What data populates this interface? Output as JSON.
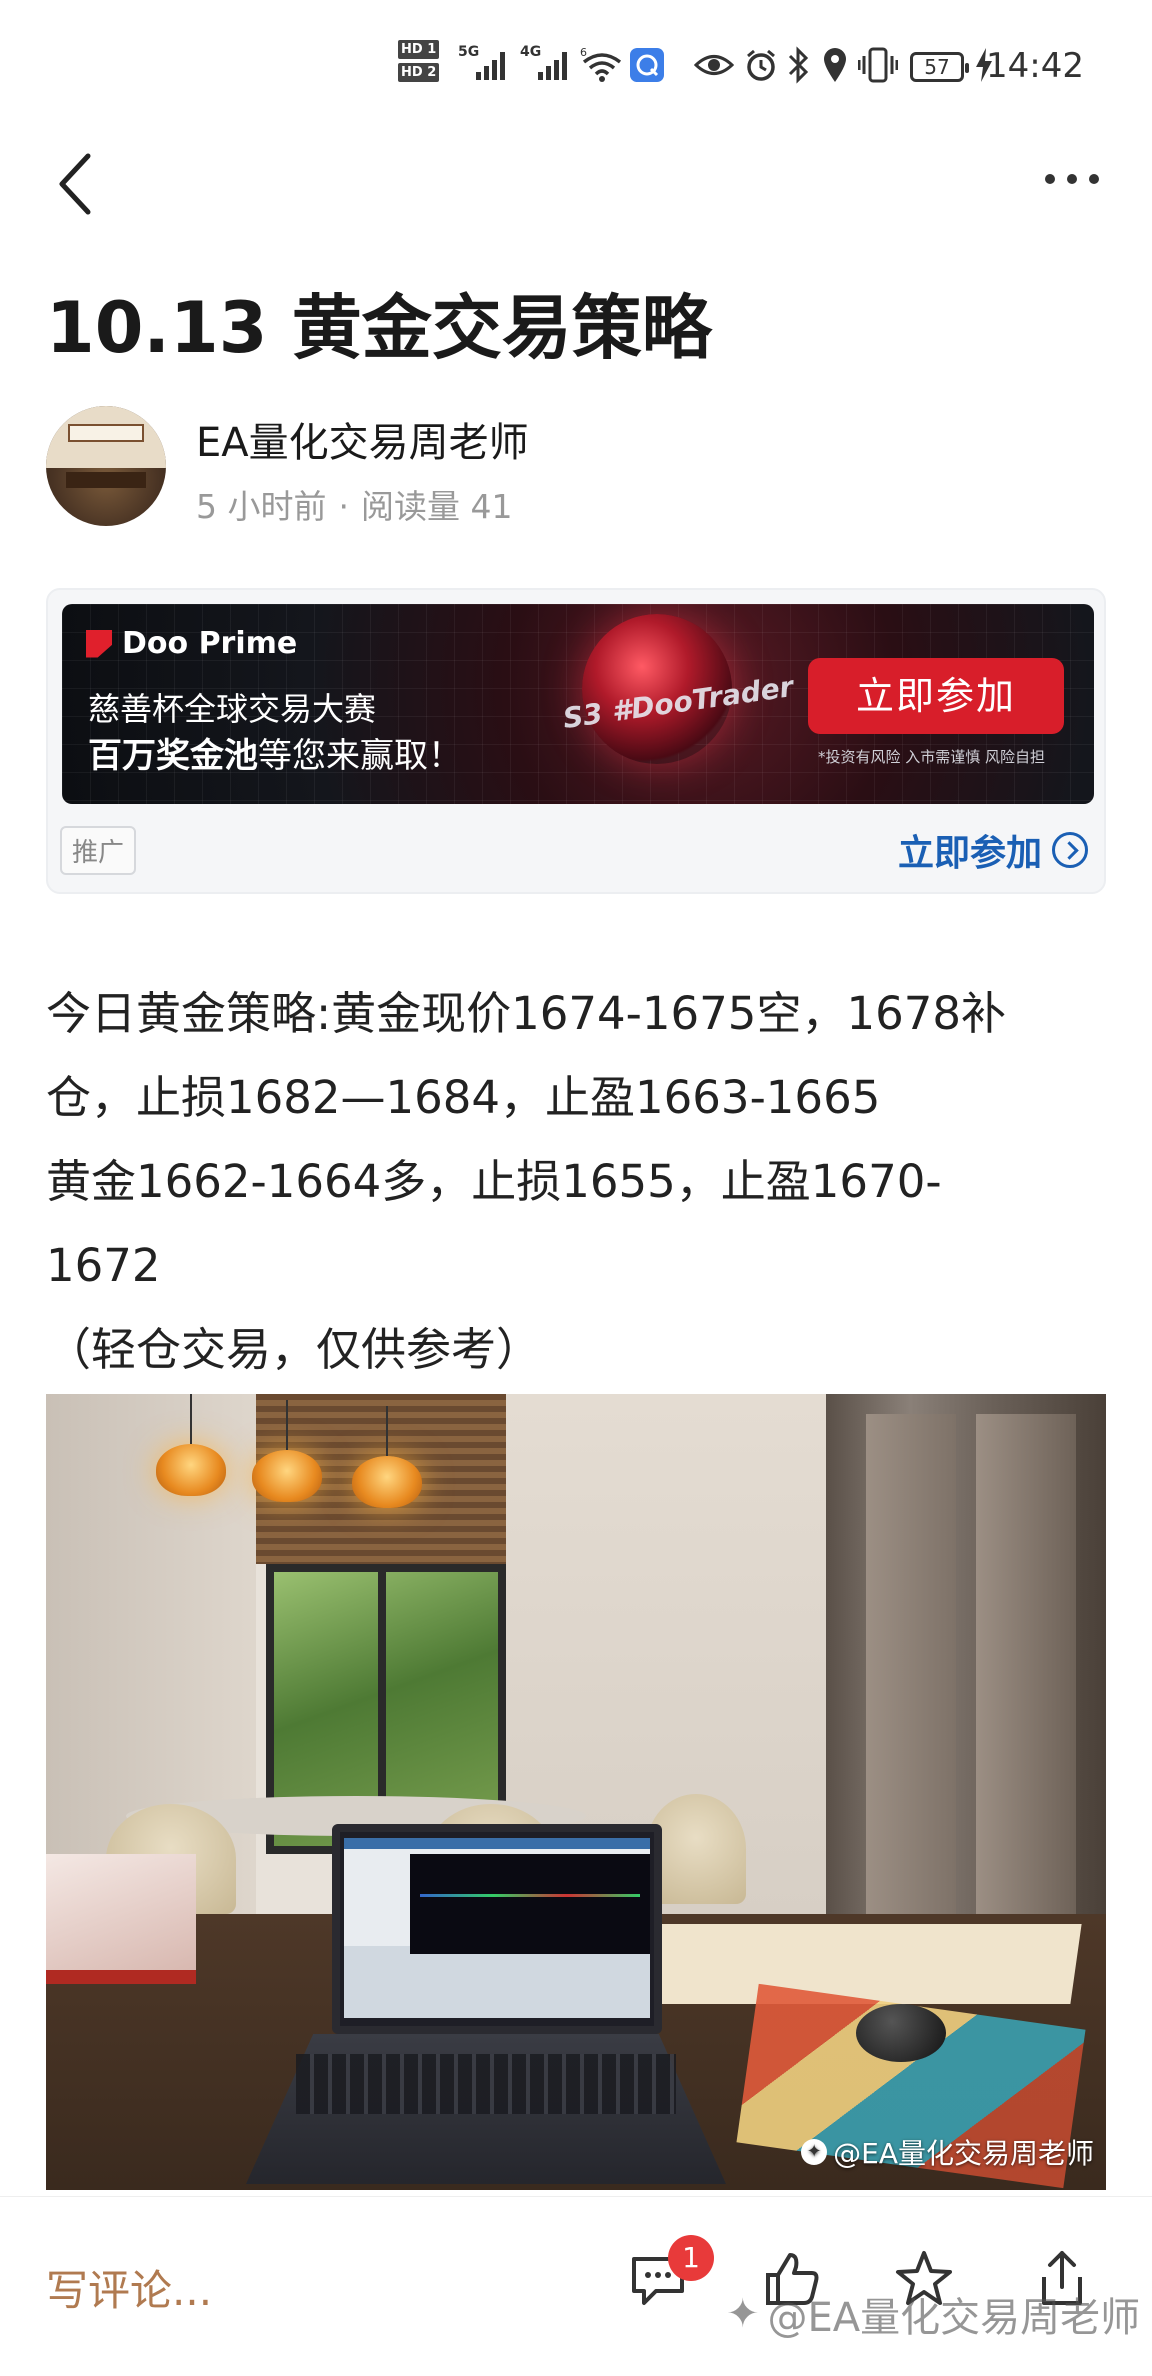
{
  "status_bar": {
    "hd1": "HD 1",
    "hd2": "HD 2",
    "network1": "5G",
    "network2": "4G",
    "network3": "6",
    "battery": "57",
    "time": "14:42"
  },
  "nav": {
    "back_icon": "chevron-left-icon",
    "more_icon": "more-horizontal-icon"
  },
  "article": {
    "title": "10.13 黄金交易策略",
    "author": "EA量化交易周老师",
    "time_ago": "5 小时前",
    "separator": "·",
    "read_count": "阅读量 41",
    "paragraphs": [
      "今日黄金策略:黄金现价1674-1675空，1678补",
      "仓，止损1682—1684，止盈1663-1665",
      "黄金1662-1664多，止损1655，止盈1670-",
      "1672",
      "（轻仓交易，仅供参考）"
    ]
  },
  "ad": {
    "brand": "Doo Prime",
    "line1": "慈善杯全球交易大赛",
    "line2_bold": "百万奖金池",
    "line2_rest": "等您来赢取！",
    "tag": "S3 #DooTrader",
    "cta": "立即参加",
    "disclaimer": "*投资有风险 入市需谨慎 风险自担",
    "badge": "推广",
    "link": "立即参加",
    "accent": "#d81e2a",
    "link_color": "#1a5fb4"
  },
  "photo": {
    "watermark": "@EA量化交易周老师"
  },
  "bottom_bar": {
    "comment_placeholder": "写评论...",
    "comment_count": "1",
    "watermark": "@EA量化交易周老师",
    "icons": [
      "comment-icon",
      "like-icon",
      "star-icon",
      "share-icon"
    ]
  }
}
